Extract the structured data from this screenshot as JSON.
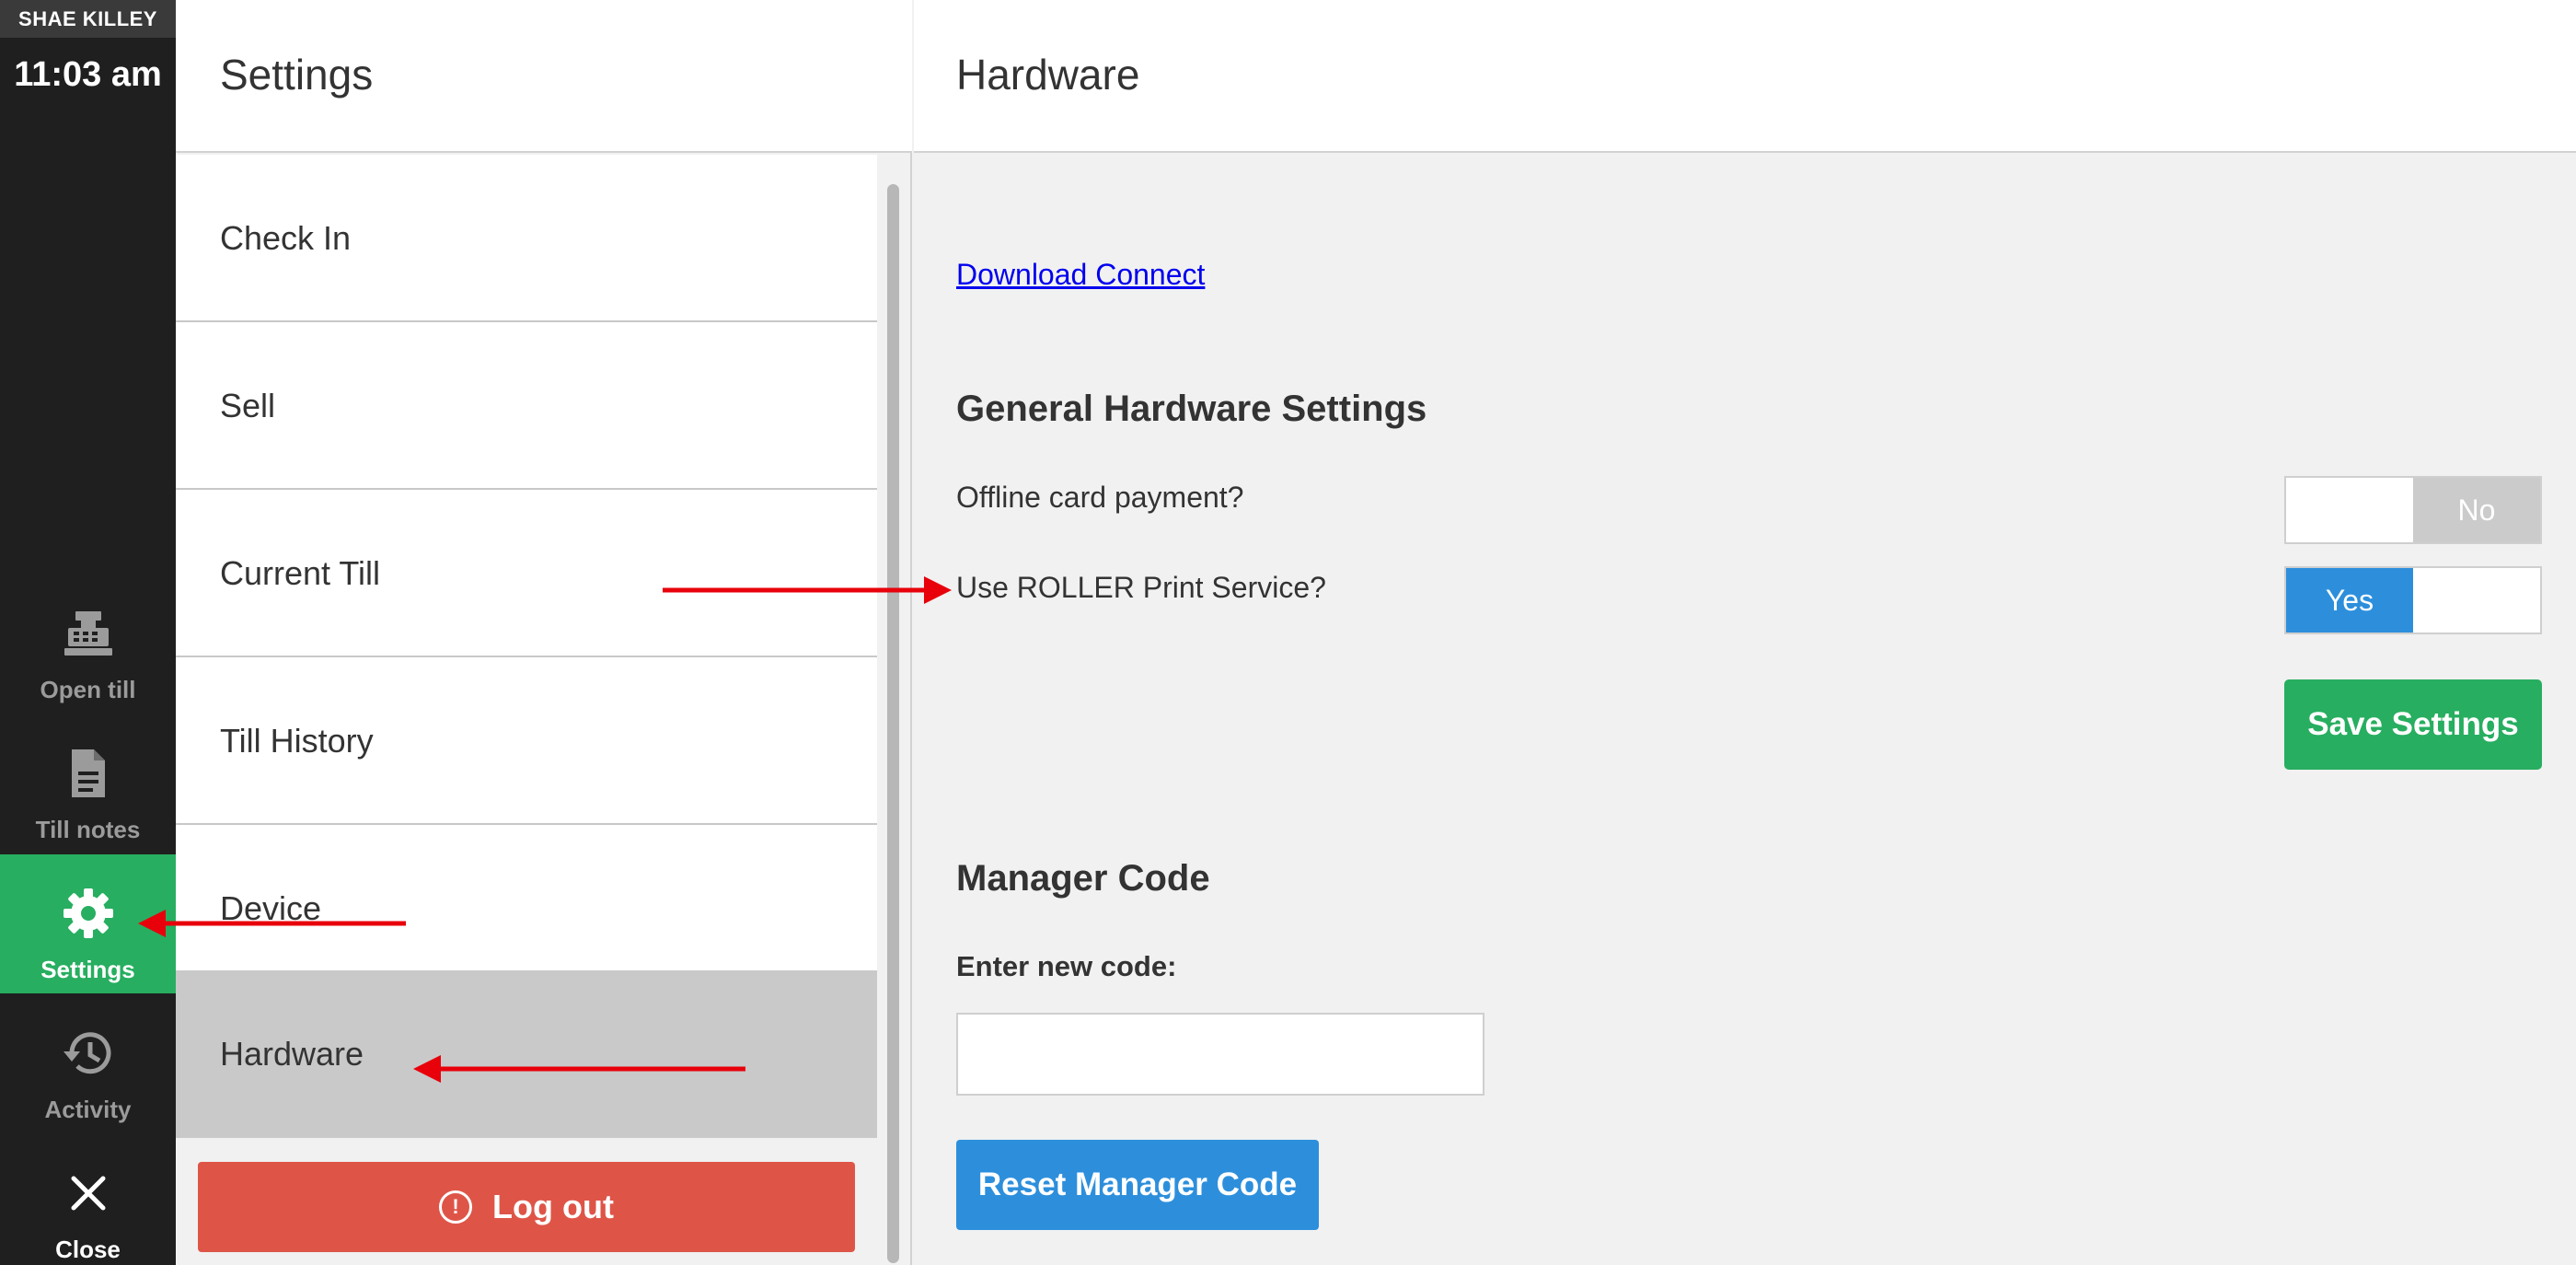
{
  "rail": {
    "user_name": "SHAE KILLEY",
    "time": "11:03 am",
    "items": [
      {
        "label": "Open till",
        "icon": "cash-register-icon"
      },
      {
        "label": "Till notes",
        "icon": "document-icon"
      },
      {
        "label": "Settings",
        "icon": "gear-icon",
        "active": true
      },
      {
        "label": "Activity",
        "icon": "history-icon"
      },
      {
        "label": "Close",
        "icon": "close-icon"
      }
    ]
  },
  "settings": {
    "title": "Settings",
    "menu": [
      {
        "label": "Check In"
      },
      {
        "label": "Sell"
      },
      {
        "label": "Current Till"
      },
      {
        "label": "Till History"
      },
      {
        "label": "Device"
      },
      {
        "label": "Hardware",
        "selected": true
      }
    ],
    "logout_label": "Log out",
    "logout_icon": "alert-circle-icon"
  },
  "hardware": {
    "title": "Hardware",
    "download_link": "Download Connect",
    "general_title": "General Hardware Settings",
    "offline_label": "Offline card payment?",
    "offline_toggle": {
      "value": "No",
      "on_label": "",
      "off_label": "No"
    },
    "print_label": "Use ROLLER Print Service?",
    "print_toggle": {
      "value": "Yes",
      "on_label": "Yes",
      "off_label": ""
    },
    "save_label": "Save Settings",
    "manager_title": "Manager Code",
    "code_label": "Enter new code:",
    "code_value": "",
    "reset_label": "Reset Manager Code"
  },
  "colors": {
    "rail_bg": "#1f1f1f",
    "active_green": "#27ae60",
    "toggle_blue": "#2d8fdc",
    "logout_red": "#de5548",
    "annotation_red": "#e8000b"
  }
}
